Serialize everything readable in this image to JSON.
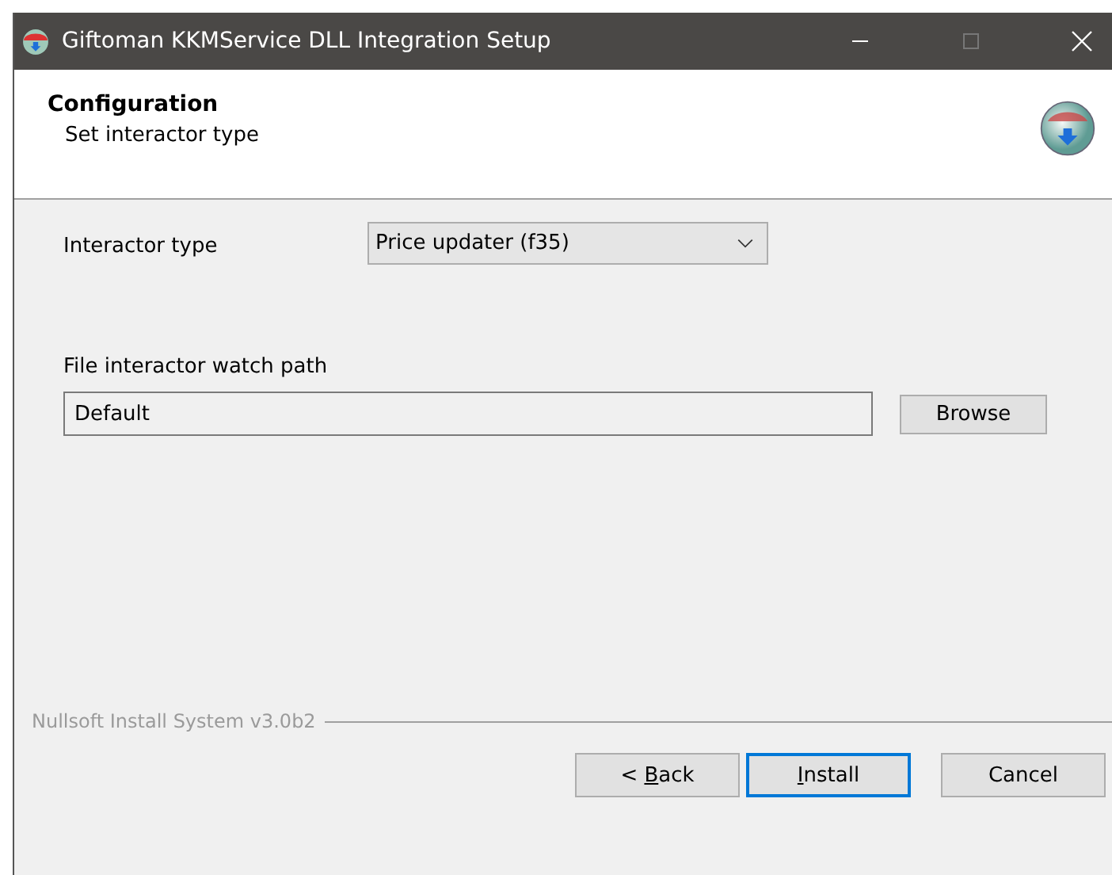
{
  "window": {
    "title": "Giftoman KKMService DLL Integration Setup"
  },
  "header": {
    "title": "Configuration",
    "subtitle": "Set interactor type"
  },
  "interactor": {
    "label": "Interactor type",
    "value": "Price updater (f35)"
  },
  "watch_path": {
    "label": "File interactor watch path",
    "value": "Default",
    "button": "Browse"
  },
  "branding": "Nullsoft Install System v3.0b2",
  "buttons": [
    {
      "parts": [
        {
          "text": "< ",
          "underline": false
        },
        {
          "text": "B",
          "underline": true
        },
        {
          "text": "ack",
          "underline": false
        }
      ],
      "default": false
    },
    {
      "parts": [
        {
          "text": "I",
          "underline": true
        },
        {
          "text": "nstall",
          "underline": false
        }
      ],
      "default": true
    },
    {
      "parts": [
        {
          "text": "Cancel",
          "underline": false
        }
      ],
      "default": false
    }
  ]
}
